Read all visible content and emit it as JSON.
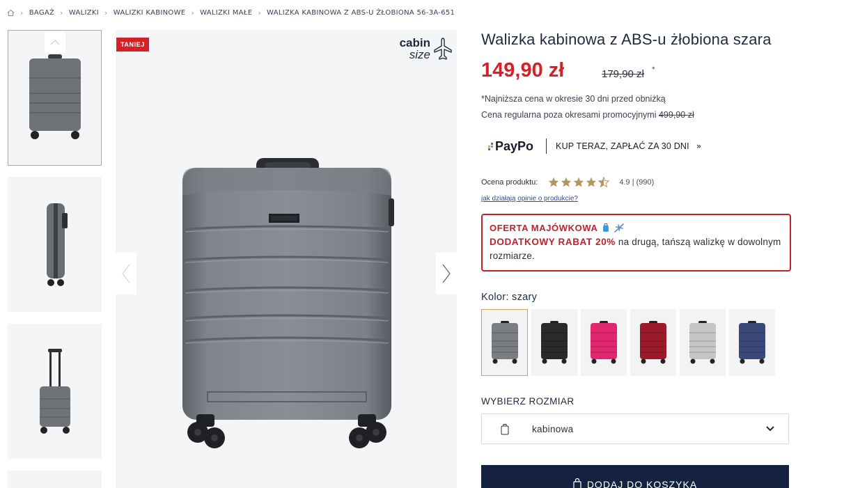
{
  "breadcrumb": {
    "items": [
      "BAGAŻ",
      "WALIZKI",
      "WALIZKI KABINOWE",
      "WALIZKI MAŁE",
      "WALIZKA KABINOWA Z ABS-U ŻŁOBIONA 56-3A-651"
    ]
  },
  "gallery": {
    "badge": "TANIEJ",
    "cabin_line1": "cabin",
    "cabin_line2": "size",
    "suitcase_brand_plate": "WITTCHEN"
  },
  "product": {
    "title": "Walizka kabinowa z ABS-u żłobiona szara",
    "price_now": "149,90 zł",
    "price_old": "179,90 zł",
    "price_old_mark": "*",
    "lowest_note": "*Najniższa cena w okresie 30 dni przed obniżką",
    "regular_note_prefix": "Cena regularna poza okresami promocyjnymi ",
    "regular_note_price": "499,90 zł"
  },
  "paypo": {
    "logo": "PayPo",
    "cta": "KUP TERAZ, ZAPŁAĆ ZA 30 DNI",
    "chevron": "»"
  },
  "rating": {
    "label": "Ocena produktu:",
    "stars": 4.5,
    "value_text": "4.9 | (990)",
    "link": "jak działają opinie o produkcie?"
  },
  "promo": {
    "title": "OFERTA MAJÓWKOWA",
    "icons": [
      "luggage-icon",
      "airplane-icon"
    ],
    "highlight": "DODATKOWY RABAT 20%",
    "body": " na drugą, tańszą walizkę w dowolnym rozmiarze."
  },
  "color": {
    "label": "Kolor: ",
    "selected": "szary",
    "swatches": [
      "#7b7e82",
      "#2a2a2c",
      "#e0276f",
      "#9c1b2b",
      "#c4c5c7",
      "#3a4a78"
    ]
  },
  "size": {
    "label": "WYBIERZ ROZMIAR",
    "selected": "kabinowa"
  },
  "cart": {
    "label": "DODAJ DO KOSZYKA"
  },
  "colors": {
    "accent_red": "#d61f26",
    "navy": "#142240",
    "gold": "#c9a76a"
  }
}
